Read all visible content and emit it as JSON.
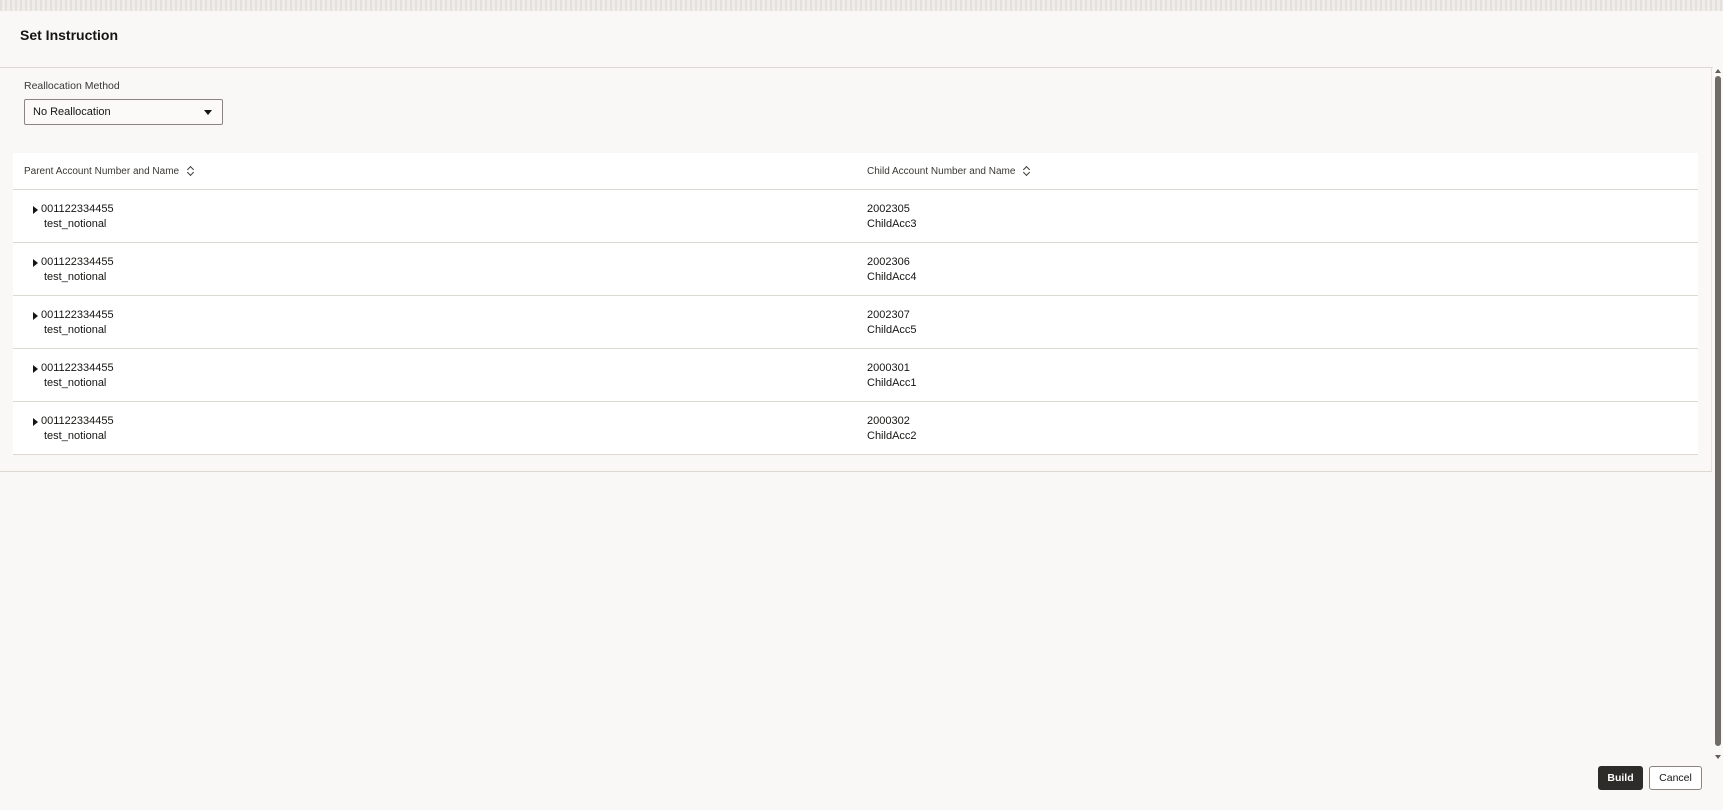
{
  "dialog": {
    "title": "Set Instruction"
  },
  "reallocation": {
    "label": "Reallocation Method",
    "selected": "No Reallocation"
  },
  "table": {
    "columns": [
      "Parent Account Number and Name",
      "Child Account Number and Name"
    ],
    "rows": [
      {
        "parent_number": "001122334455",
        "parent_name": "test_notional",
        "child_number": "2002305",
        "child_name": "ChildAcc3"
      },
      {
        "parent_number": "001122334455",
        "parent_name": "test_notional",
        "child_number": "2002306",
        "child_name": "ChildAcc4"
      },
      {
        "parent_number": "001122334455",
        "parent_name": "test_notional",
        "child_number": "2002307",
        "child_name": "ChildAcc5"
      },
      {
        "parent_number": "001122334455",
        "parent_name": "test_notional",
        "child_number": "2000301",
        "child_name": "ChildAcc1"
      },
      {
        "parent_number": "001122334455",
        "parent_name": "test_notional",
        "child_number": "2000302",
        "child_name": "ChildAcc2"
      }
    ]
  },
  "footer": {
    "build_label": "Build",
    "cancel_label": "Cancel"
  }
}
